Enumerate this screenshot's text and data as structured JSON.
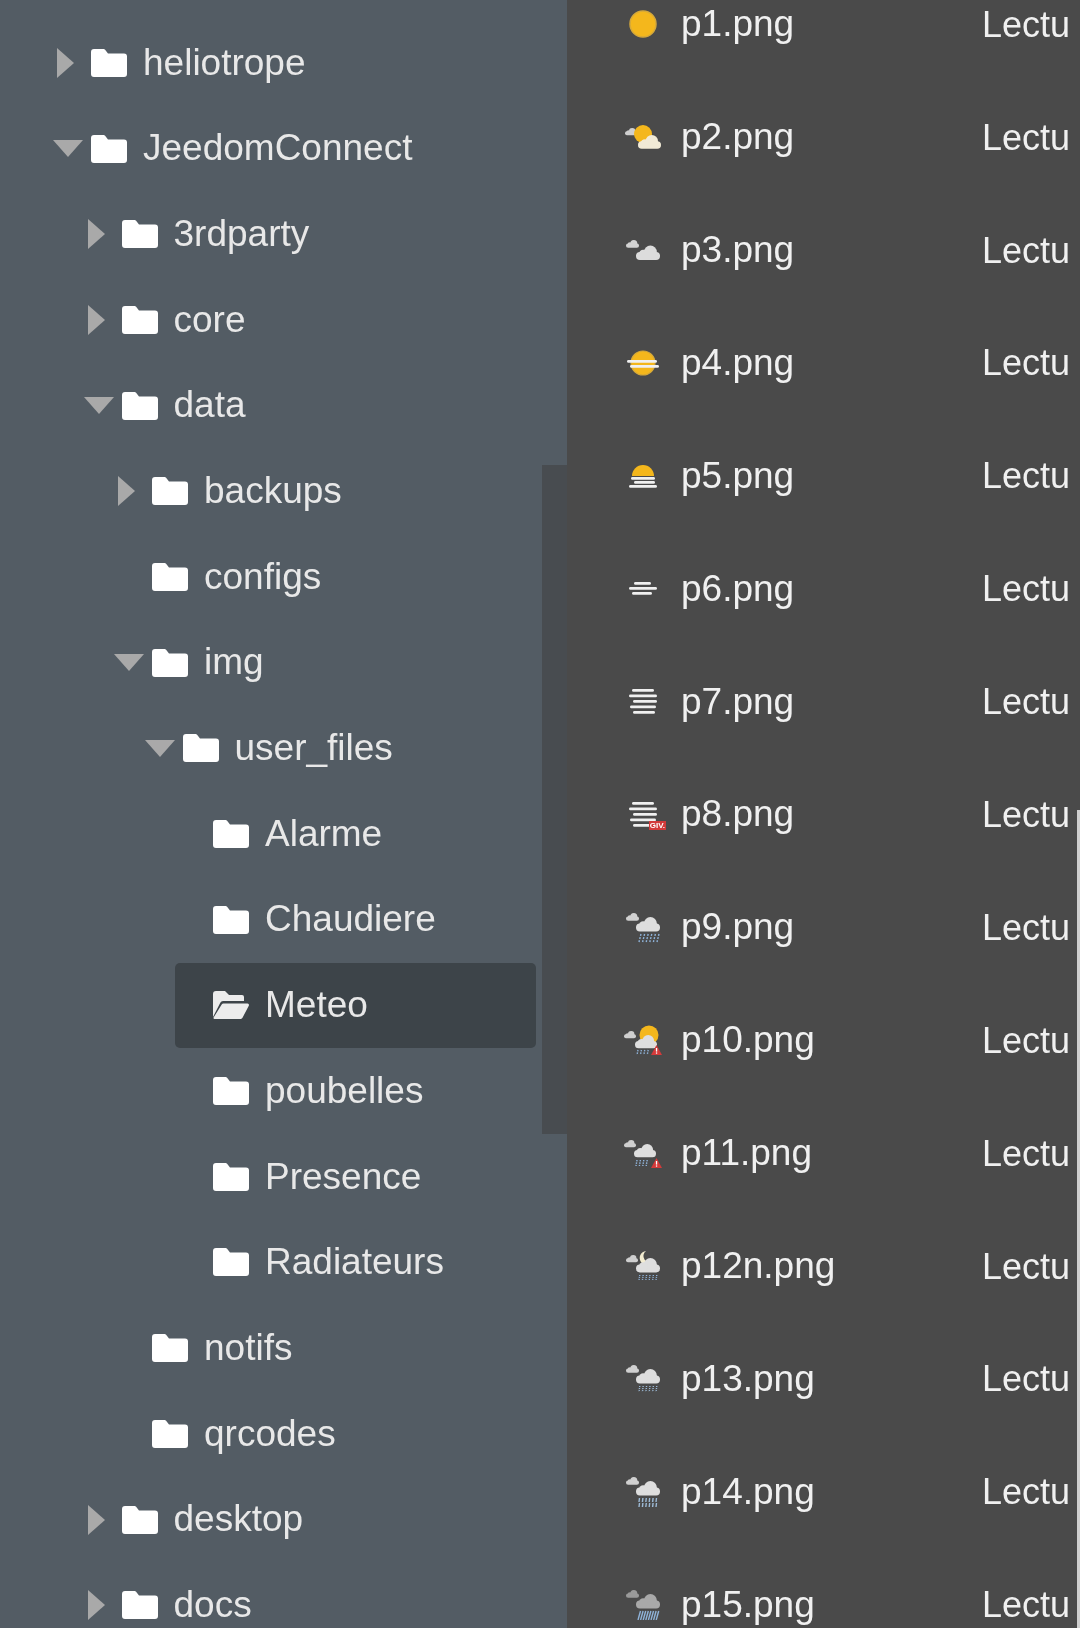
{
  "folder_tree": [
    {
      "label": "heliotrope",
      "expanded": false,
      "selected": false
    },
    {
      "label": "JeedomConnect",
      "expanded": true,
      "selected": false,
      "children": [
        {
          "label": "3rdparty",
          "expanded": false,
          "selected": false
        },
        {
          "label": "core",
          "expanded": false,
          "selected": false
        },
        {
          "label": "data",
          "expanded": true,
          "selected": false,
          "children": [
            {
              "label": "backups",
              "expanded": false,
              "selected": false
            },
            {
              "label": "configs",
              "selected": false
            },
            {
              "label": "img",
              "expanded": true,
              "selected": false,
              "children": [
                {
                  "label": "user_files",
                  "expanded": true,
                  "selected": false,
                  "children": [
                    {
                      "label": "Alarme",
                      "selected": false
                    },
                    {
                      "label": "Chaudiere",
                      "selected": false
                    },
                    {
                      "label": "Meteo",
                      "selected": true
                    },
                    {
                      "label": "poubelles",
                      "selected": false
                    },
                    {
                      "label": "Presence",
                      "selected": false
                    },
                    {
                      "label": "Radiateurs",
                      "selected": false
                    }
                  ]
                }
              ]
            },
            {
              "label": "notifs",
              "selected": false
            },
            {
              "label": "qrcodes",
              "selected": false
            }
          ]
        },
        {
          "label": "desktop",
          "expanded": false,
          "selected": false
        },
        {
          "label": "docs",
          "expanded": false,
          "selected": false
        }
      ]
    }
  ],
  "files": [
    {
      "name": "p1.png",
      "kind": "sun",
      "column_2": "Lectu"
    },
    {
      "name": "p2.png",
      "kind": "partly",
      "column_2": "Lectu"
    },
    {
      "name": "p3.png",
      "kind": "cloudy",
      "column_2": "Lectu"
    },
    {
      "name": "p4.png",
      "kind": "sunfog",
      "column_2": "Lectu"
    },
    {
      "name": "p5.png",
      "kind": "sunmist",
      "column_2": "Lectu"
    },
    {
      "name": "p6.png",
      "kind": "mist",
      "column_2": "Lectu"
    },
    {
      "name": "p7.png",
      "kind": "fog",
      "column_2": "Lectu"
    },
    {
      "name": "p8.png",
      "kind": "frost",
      "tag": "GIV.",
      "column_2": "Lectu"
    },
    {
      "name": "p9.png",
      "kind": "rain",
      "column_2": "Lectu"
    },
    {
      "name": "p10.png",
      "kind": "sunstorm",
      "column_2": "Lectu"
    },
    {
      "name": "p11.png",
      "kind": "storm",
      "column_2": "Lectu"
    },
    {
      "name": "p12n.png",
      "kind": "nightrain",
      "column_2": "Lectu"
    },
    {
      "name": "p13.png",
      "kind": "drizzle",
      "column_2": "Lectu"
    },
    {
      "name": "p14.png",
      "kind": "showers",
      "column_2": "Lectu"
    },
    {
      "name": "p15.png",
      "kind": "downpour",
      "column_2": "Lectu"
    }
  ]
}
